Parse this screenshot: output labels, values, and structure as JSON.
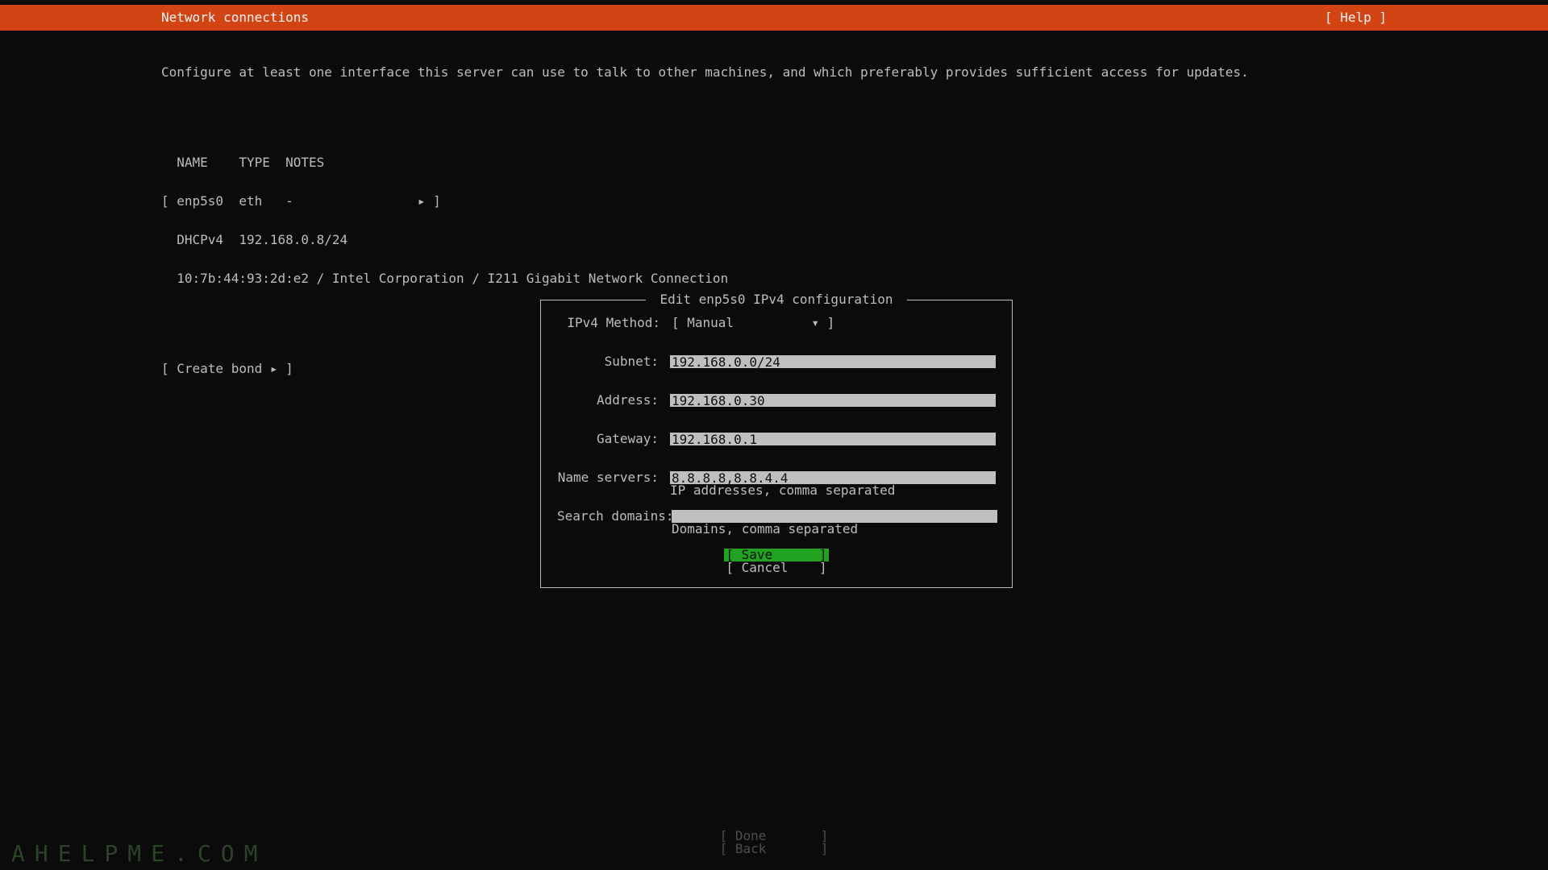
{
  "header": {
    "title": "Network connections",
    "help_label": "[ Help ]"
  },
  "instructions": "Configure at least one interface this server can use to talk to other machines, and which preferably provides sufficient access for updates.",
  "network": {
    "header_line": "  NAME    TYPE  NOTES",
    "line1": "[ enp5s0  eth   -                ▸ ]",
    "line2": "  DHCPv4  192.168.0.8/24",
    "line3": "  10:7b:44:93:2d:e2 / Intel Corporation / I211 Gigabit Network Connection",
    "create_bond": "[ Create bond ▸ ]"
  },
  "dialog": {
    "title": " Edit enp5s0 IPv4 configuration ",
    "method_label": "IPv4 Method:",
    "method_value": "[ Manual          ▾ ]",
    "subnet_label": "Subnet:",
    "subnet_value": "192.168.0.0/24",
    "address_label": "Address:",
    "address_value": "192.168.0.30",
    "gateway_label": "Gateway:",
    "gateway_value": "192.168.0.1",
    "ns_label": "Name servers:",
    "ns_value": "8.8.8.8,8.8.4.4",
    "ns_hint": "IP addresses, comma separated",
    "sd_label": "Search domains:",
    "sd_value": "",
    "sd_hint": "Domains, comma separated",
    "save_label": "[ Save      ]",
    "cancel_label": "[ Cancel    ]"
  },
  "footer": {
    "done_label": "[ Done       ]",
    "back_label": "[ Back       ]"
  },
  "watermark": "AHELPME.COM"
}
